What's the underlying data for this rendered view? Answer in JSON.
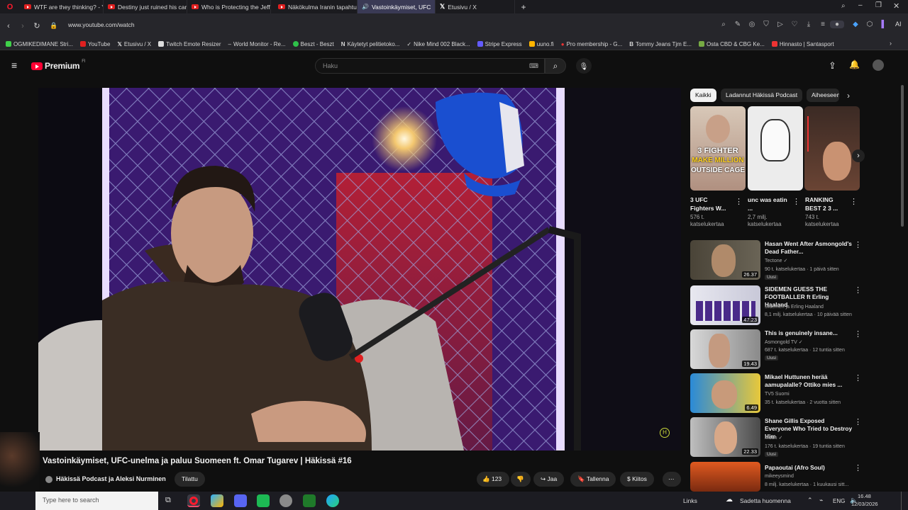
{
  "browser": {
    "tabs": [
      {
        "title": "WTF are they thinking? - Y",
        "icon": "youtube"
      },
      {
        "title": "Destiny just ruined his car",
        "icon": "youtube"
      },
      {
        "title": "Who is Protecting the Jeff",
        "icon": "youtube"
      },
      {
        "title": "Näkökulma Iranin tapahtu",
        "icon": "youtube"
      },
      {
        "title": "Vastoinkäymiset, UFC",
        "icon": "youtube",
        "active": true
      },
      {
        "title": "Etusivu / X",
        "icon": "x"
      }
    ],
    "url": "www.youtube.com/watch",
    "ai_label": "AI",
    "bookmarks": [
      "OGMIKEDIMANE Stri...",
      "YouTube",
      "Etusivu / X",
      "Twitch Emote Resizer",
      "World Monitor - Re...",
      "Beszt - Beszt",
      "Käytetyt pelitietoko...",
      "Nike Mind 002 Black...",
      "Stripe Express",
      "uuno.fi",
      "Pro membership - G...",
      "Tommy Jeans Tjm E...",
      "Osta CBD & CBG Ke...",
      "Hinnasto | Santasport"
    ]
  },
  "youtube": {
    "logo": "Premium",
    "logo_region": "FI",
    "search_placeholder": "Haku",
    "video": {
      "title": "Vastoinkäymiset, UFC-unelma ja paluu Suomeen ft. Omar Tugarev | Häkissä #16",
      "channel": "Häkissä Podcast ja Aleksi Nurminen",
      "subscribe_label": "Tilattu",
      "likes": "123",
      "share_label": "Jaa",
      "save_label": "Tallenna",
      "thanks_label": "Kiitos"
    },
    "chips": [
      "Kaikki",
      "Ladannut Häkissä Podcast",
      "Aiheeseen"
    ],
    "shorts": [
      {
        "title": "3 UFC Fighters W...",
        "views": "576 t. katselukertaa",
        "overlay": [
          "3 FIGHTER",
          "MAKE MILLION",
          "OUTSIDE CAGE"
        ]
      },
      {
        "title": "unc was eatin ...",
        "views": "2,7 milj. katselukertaa"
      },
      {
        "title": "RANKING BEST 2 3 ...",
        "views": "743 t. katselukertaa"
      }
    ],
    "recommendations": [
      {
        "title": "Hasan Went After Asmongold's Dead Father...",
        "channel": "Tectone",
        "meta": "90 t. katselukertaa · 1 päivä sitten",
        "badge": "Uusi",
        "duration": "26.37"
      },
      {
        "title": "SIDEMEN GUESS THE FOOTBALLER ft Erling Haaland",
        "channel": "Sidemen ja Erling Haaland",
        "meta": "8,1 milj. katselukertaa · 10 päivää sitten",
        "badge": "",
        "duration": "47.23"
      },
      {
        "title": "This is genuinely insane...",
        "channel": "Asmongold TV",
        "meta": "687 t. katselukertaa · 12 tuntia sitten",
        "badge": "Uusi",
        "duration": "19.43"
      },
      {
        "title": "Mikael Huttunen herää aamupalalle? Ottiko mies ...",
        "channel": "TV5 Suomi",
        "meta": "35 t. katselukertaa · 2 vuotta sitten",
        "badge": "",
        "duration": "6.49"
      },
      {
        "title": "Shane Gillis Exposed Everyone Who Tried to Destroy Him",
        "channel": "Moon",
        "meta": "176 t. katselukertaa · 19 tuntia sitten",
        "badge": "Uusi",
        "duration": "22.33"
      },
      {
        "title": "Papaoutai (Afro Soul)",
        "channel": "mikeeysmind",
        "meta": "8 milj. katselukertaa · 1 kuukausi sitt...",
        "badge": "",
        "duration": ""
      }
    ]
  },
  "taskbar": {
    "search_placeholder": "Type here to search",
    "links_label": "Links",
    "weather": "Sadetta huomenna",
    "lang": "ENG",
    "time": "16.48",
    "date": "12/03/2026"
  },
  "colors": {
    "youtube_red": "#ff0033",
    "background": "#0f0f0f",
    "chip_selected": "#f1f1f1"
  }
}
